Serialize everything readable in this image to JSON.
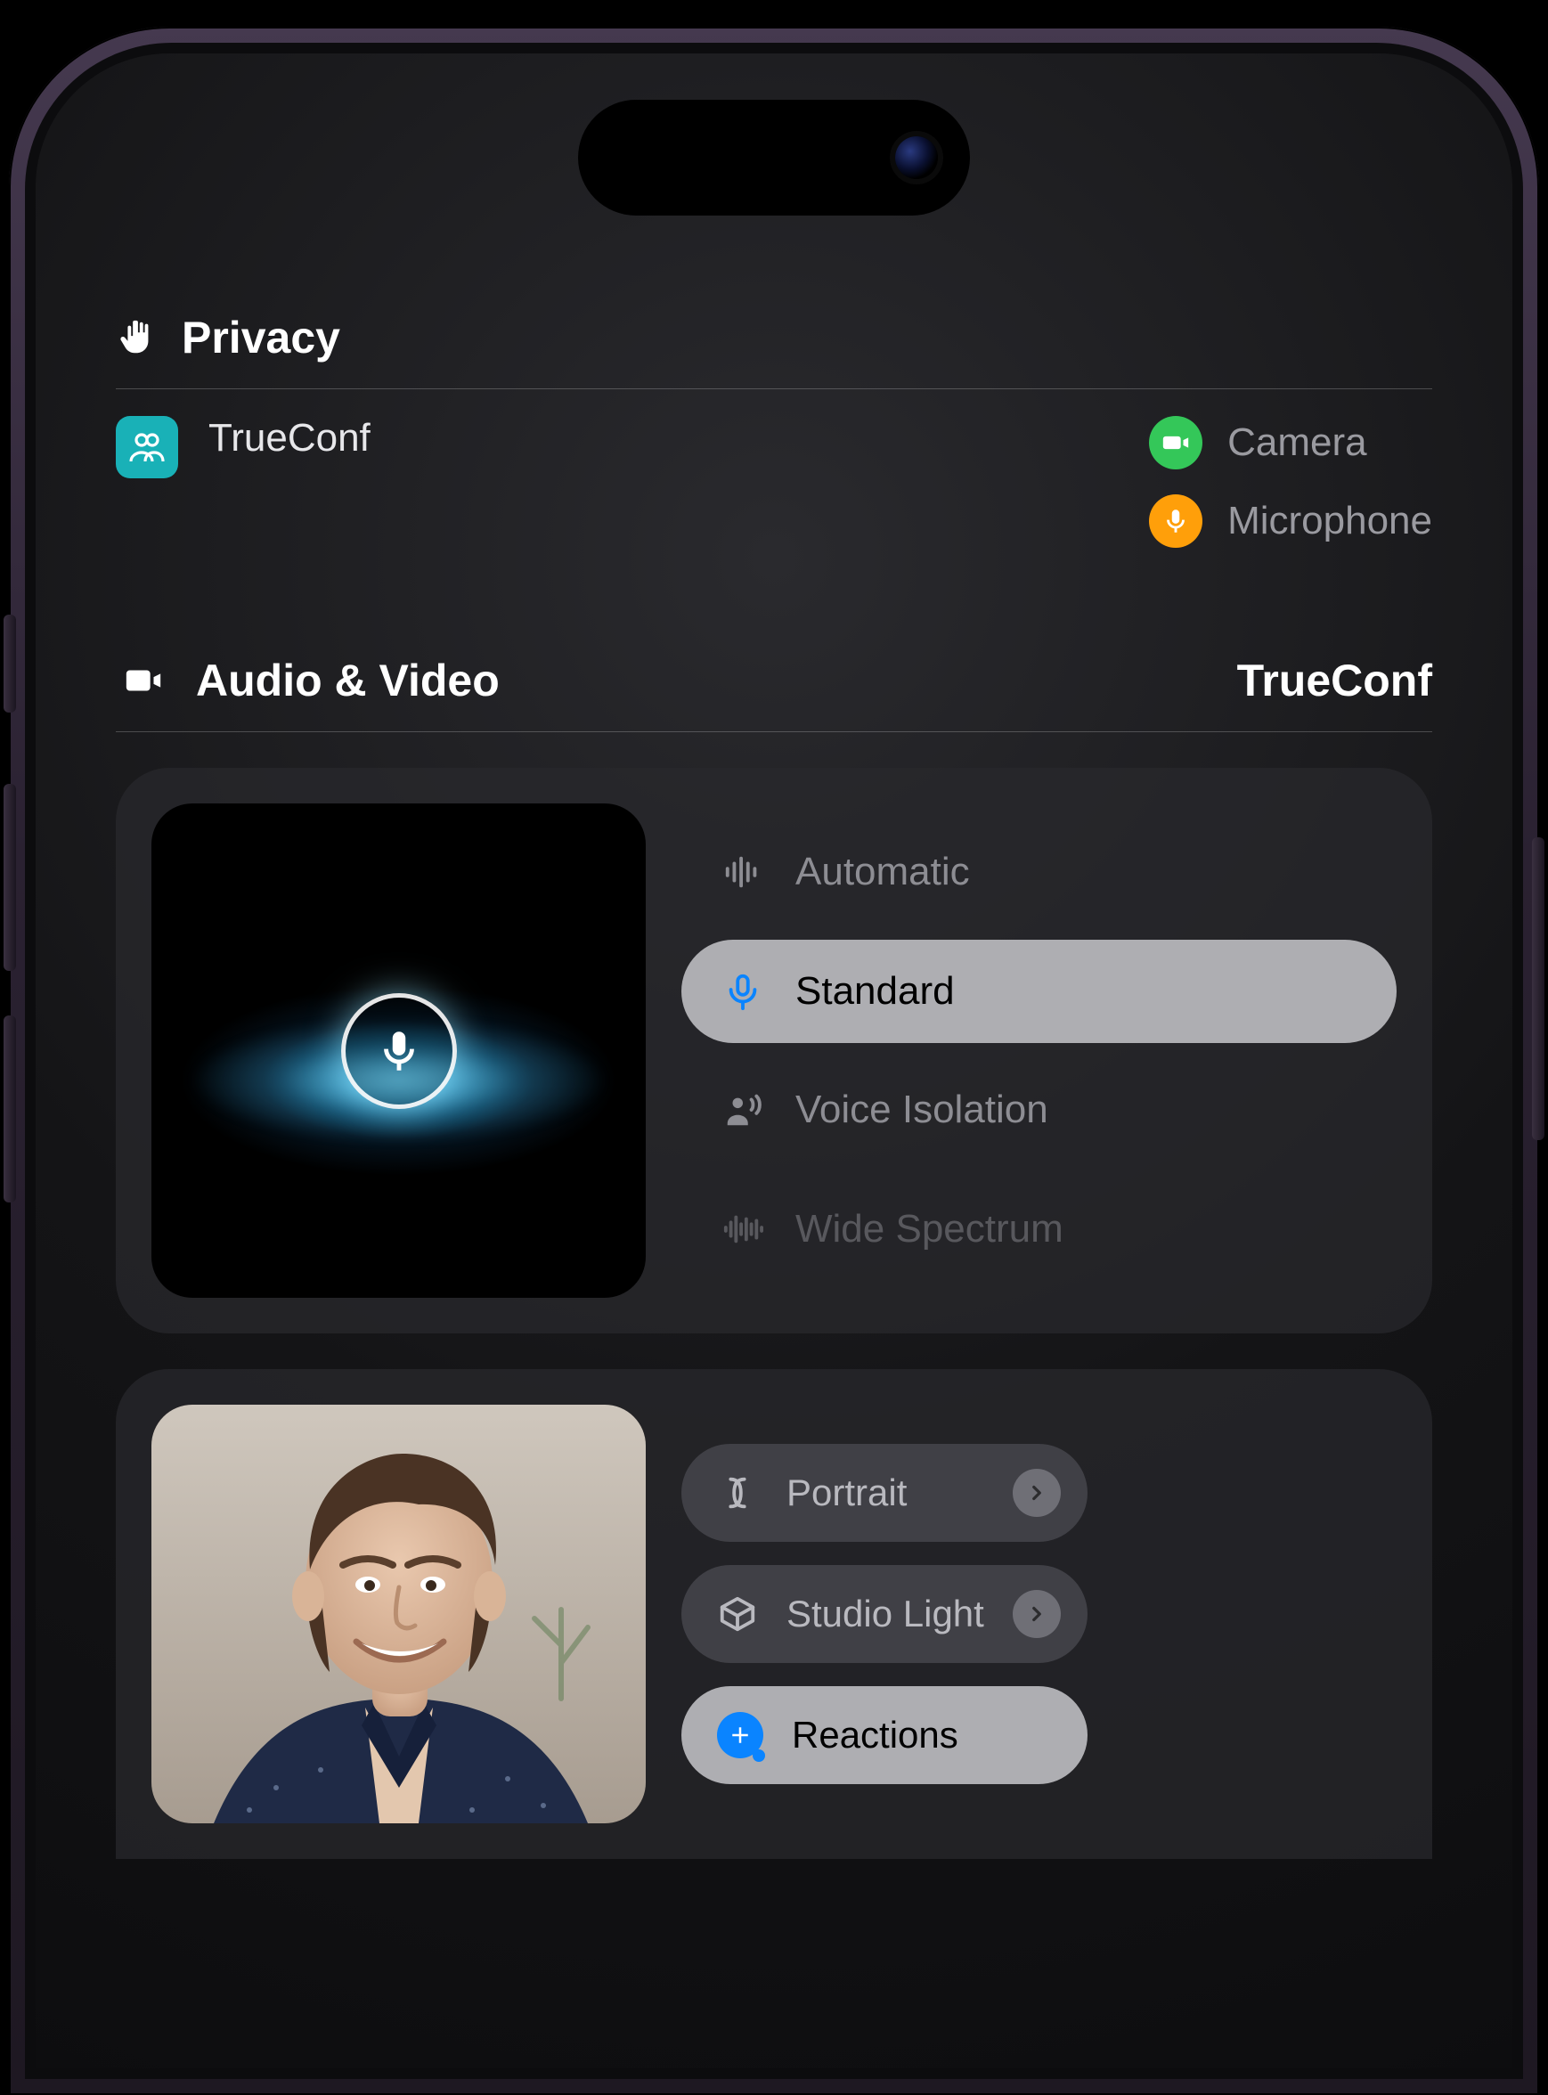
{
  "privacy": {
    "title": "Privacy",
    "app_name": "TrueConf",
    "indicators": {
      "camera_label": "Camera",
      "mic_label": "Microphone"
    }
  },
  "av": {
    "title": "Audio & Video",
    "app_name": "TrueConf",
    "mic_modes": {
      "auto": "Automatic",
      "standard": "Standard",
      "voice_isolation": "Voice Isolation",
      "wide_spectrum": "Wide Spectrum",
      "selected": "standard"
    },
    "video_effects": {
      "portrait": "Portrait",
      "studio_light": "Studio Light",
      "reactions": "Reactions"
    }
  },
  "colors": {
    "camera_indicator": "#34c759",
    "mic_indicator": "#ff9f0a",
    "accent_blue": "#0a84ff",
    "trueconf_badge": "#19b1b7"
  }
}
